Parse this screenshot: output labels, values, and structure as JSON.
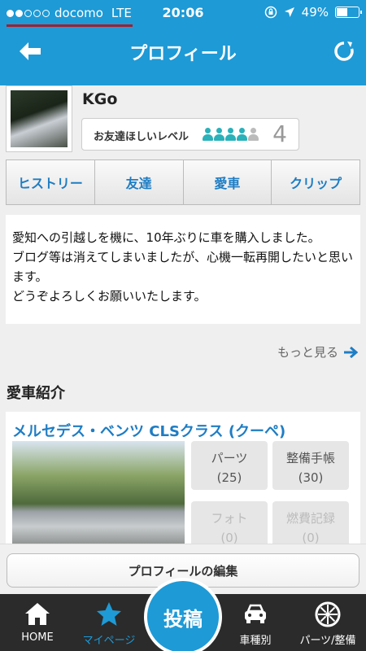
{
  "status": {
    "carrier": "docomo",
    "network": "LTE",
    "time": "20:06",
    "battery": "49%",
    "battery_level": 0.49,
    "signal_bars": 2
  },
  "nav": {
    "title": "プロフィール"
  },
  "profile": {
    "username": "KGo",
    "friend_label": "お友達ほしいレベル",
    "friend_level": "4",
    "friend_max": 5
  },
  "tabs": [
    "ヒストリー",
    "友達",
    "愛車",
    "クリップ"
  ],
  "intro": {
    "lines": [
      " 愛知への引越しを機に、10年ぶりに車を購入しました。",
      "ブログ等は消えてしまいましたが、心機一転再開したいと思います。",
      "どうぞよろしくお願いいたします。"
    ]
  },
  "more_label": "もっと見る",
  "cars_section": {
    "title": "愛車紹介",
    "car_name": "メルセデス・ベンツ CLSクラス (クーペ)",
    "stats": [
      {
        "label": "パーツ",
        "count": "(25)",
        "active": true
      },
      {
        "label": "整備手帳",
        "count": "(30)",
        "active": true
      },
      {
        "label": "フォト",
        "count": "(0)",
        "active": false
      },
      {
        "label": "燃費記録",
        "count": "(0)",
        "active": false
      }
    ]
  },
  "edit_button": "プロフィールの編集",
  "tabbar": {
    "home": "HOME",
    "mypage": "マイページ",
    "post": "投稿",
    "car_types": "車種別",
    "parts": "パーツ/整備"
  },
  "colors": {
    "brand": "#1e9ad6",
    "link": "#1e7dc4",
    "active_tab": "#1e9ad6"
  }
}
